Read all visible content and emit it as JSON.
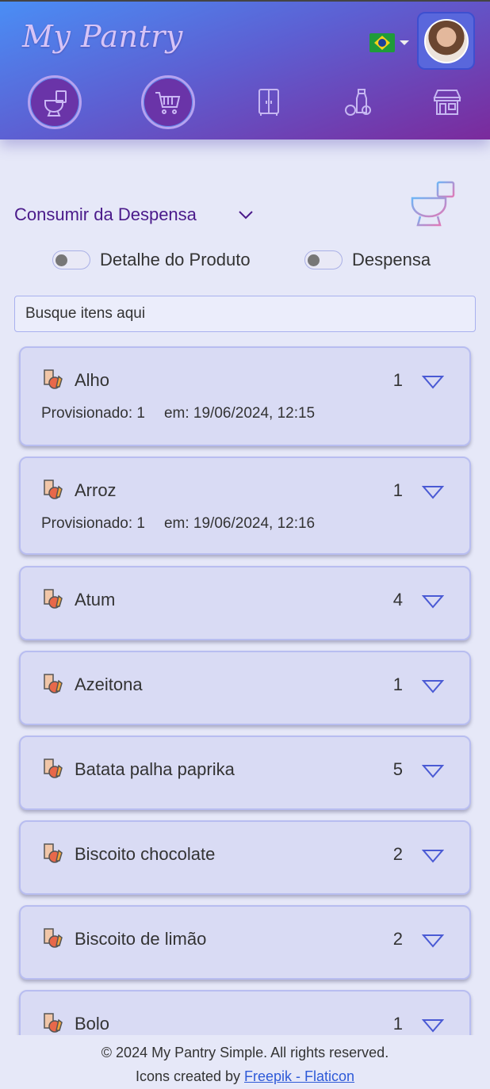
{
  "header": {
    "logo": "My Pantry",
    "language_flag": "brazil-flag-icon",
    "avatar": "user-avatar",
    "nav": [
      {
        "name": "consume",
        "icon": "toilet-consume-icon",
        "active": true
      },
      {
        "name": "shopping",
        "icon": "shopping-cart-icon",
        "active": true
      },
      {
        "name": "pantry",
        "icon": "cupboard-icon",
        "active": false
      },
      {
        "name": "products",
        "icon": "groceries-icon",
        "active": false
      },
      {
        "name": "stores",
        "icon": "store-icon",
        "active": false
      }
    ]
  },
  "section": {
    "title": "Consumir da Despensa",
    "hero_icon": "toilet-consume-icon"
  },
  "toggles": [
    {
      "label": "Detalhe do Produto",
      "on": false
    },
    {
      "label": "Despensa",
      "on": false
    }
  ],
  "search": {
    "placeholder": "Busque itens aqui"
  },
  "items": [
    {
      "name": "Alho",
      "qty": "1",
      "provisioned": "Provisionado: 1",
      "date": "em: 19/06/2024, 12:15"
    },
    {
      "name": "Arroz",
      "qty": "1",
      "provisioned": "Provisionado: 1",
      "date": "em: 19/06/2024, 12:16"
    },
    {
      "name": "Atum",
      "qty": "4"
    },
    {
      "name": "Azeitona",
      "qty": "1"
    },
    {
      "name": "Batata palha paprika",
      "qty": "5"
    },
    {
      "name": "Biscoito chocolate",
      "qty": "2"
    },
    {
      "name": "Biscoito de limão",
      "qty": "2"
    },
    {
      "name": "Bolo",
      "qty": "1"
    }
  ],
  "footer": {
    "copyright": "© 2024 My Pantry Simple. All rights reserved.",
    "credit_prefix": "Icons created by ",
    "credit_link": "Freepik - Flaticon"
  },
  "colors": {
    "header_gradient_start": "#4a8ef5",
    "header_gradient_end": "#7b2a9c",
    "title": "#4a1a8a",
    "card_bg": "#d9dbf4",
    "accent": "#5b5fd6"
  }
}
